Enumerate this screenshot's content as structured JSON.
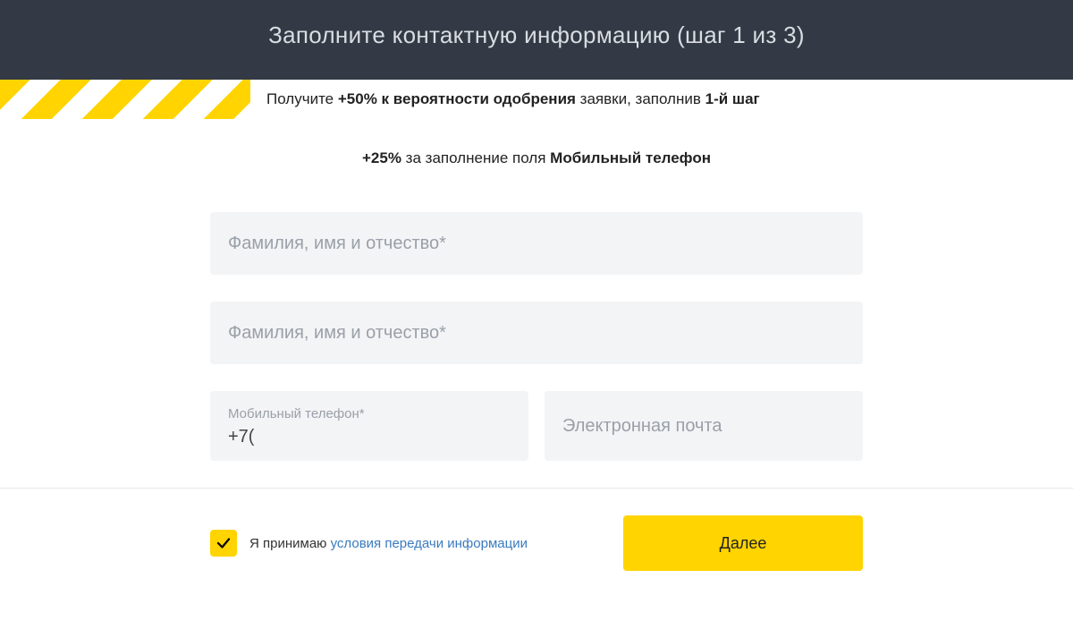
{
  "header": {
    "title": "Заполните контактную информацию (шаг 1 из 3)"
  },
  "approval": {
    "prefix": "Получите ",
    "bonus": "+50%",
    "mid": " к вероятности одобрения",
    "suffix": " заявки, заполнив ",
    "step": "1-й шаг"
  },
  "tip": {
    "bonus": "+25%",
    "text": " за заполнение поля ",
    "field": "Мобильный телефон"
  },
  "form": {
    "fio1_placeholder": "Фамилия, имя и отчество*",
    "fio2_placeholder": "Фамилия, имя и отчество*",
    "phone_label": "Мобильный телефон*",
    "phone_value": "+7(",
    "email_placeholder": "Электронная почта"
  },
  "accept": {
    "checked": true,
    "text": "Я принимаю ",
    "link": "условия передачи информации"
  },
  "next_label": "Далее"
}
